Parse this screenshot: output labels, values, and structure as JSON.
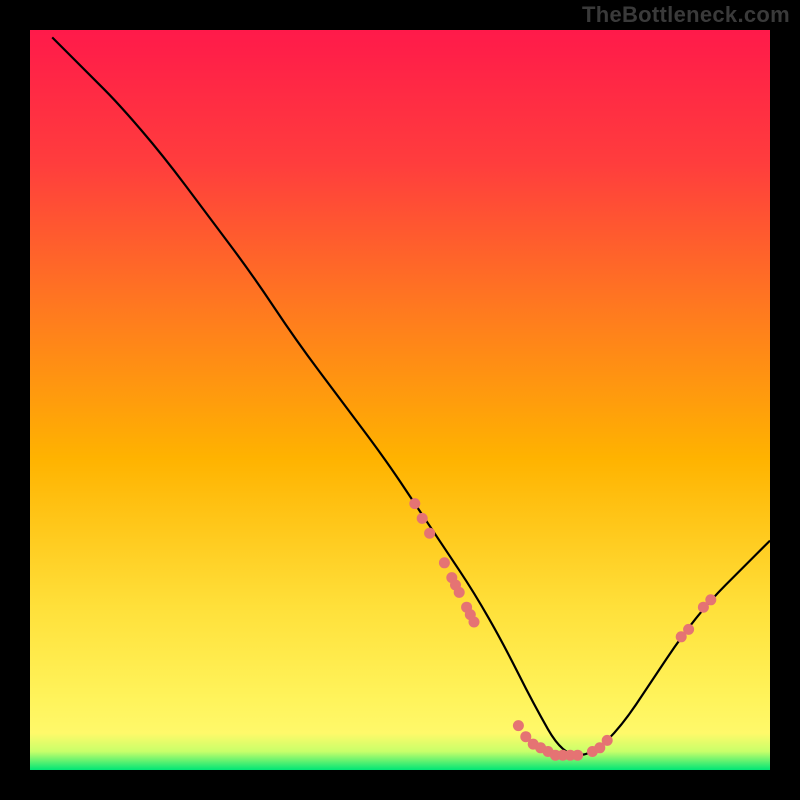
{
  "watermark": "TheBottleneck.com",
  "chart_data": {
    "type": "line",
    "title": "",
    "xlabel": "",
    "ylabel": "",
    "xlim": [
      0,
      100
    ],
    "ylim": [
      0,
      100
    ],
    "gradient_colors": {
      "top": "#ff1744",
      "upper_mid": "#ff6d00",
      "mid": "#ffd600",
      "lower_mid": "#ffee58",
      "bottom_band": "#00e676"
    },
    "curve": {
      "comment": "V-shaped curve with minimum near x≈72",
      "x": [
        3,
        8,
        12,
        18,
        24,
        30,
        36,
        42,
        48,
        52,
        56,
        60,
        64,
        68,
        72,
        76,
        80,
        84,
        88,
        92,
        96,
        100
      ],
      "y": [
        99,
        94,
        90,
        83,
        75,
        67,
        58,
        50,
        42,
        36,
        30,
        24,
        17,
        9,
        2,
        2,
        6,
        12,
        18,
        23,
        27,
        31
      ]
    },
    "scatter_points": {
      "comment": "Highlighted dots along curve (coral)",
      "color": "#e57373",
      "points": [
        {
          "x": 52,
          "y": 36
        },
        {
          "x": 53,
          "y": 34
        },
        {
          "x": 54,
          "y": 32
        },
        {
          "x": 56,
          "y": 28
        },
        {
          "x": 57,
          "y": 26
        },
        {
          "x": 57.5,
          "y": 25
        },
        {
          "x": 58,
          "y": 24
        },
        {
          "x": 59,
          "y": 22
        },
        {
          "x": 59.5,
          "y": 21
        },
        {
          "x": 60,
          "y": 20
        },
        {
          "x": 66,
          "y": 6
        },
        {
          "x": 67,
          "y": 4.5
        },
        {
          "x": 68,
          "y": 3.5
        },
        {
          "x": 69,
          "y": 3
        },
        {
          "x": 70,
          "y": 2.5
        },
        {
          "x": 71,
          "y": 2
        },
        {
          "x": 72,
          "y": 2
        },
        {
          "x": 73,
          "y": 2
        },
        {
          "x": 74,
          "y": 2
        },
        {
          "x": 76,
          "y": 2.5
        },
        {
          "x": 77,
          "y": 3
        },
        {
          "x": 78,
          "y": 4
        },
        {
          "x": 88,
          "y": 18
        },
        {
          "x": 89,
          "y": 19
        },
        {
          "x": 91,
          "y": 22
        },
        {
          "x": 92,
          "y": 23
        }
      ]
    }
  }
}
